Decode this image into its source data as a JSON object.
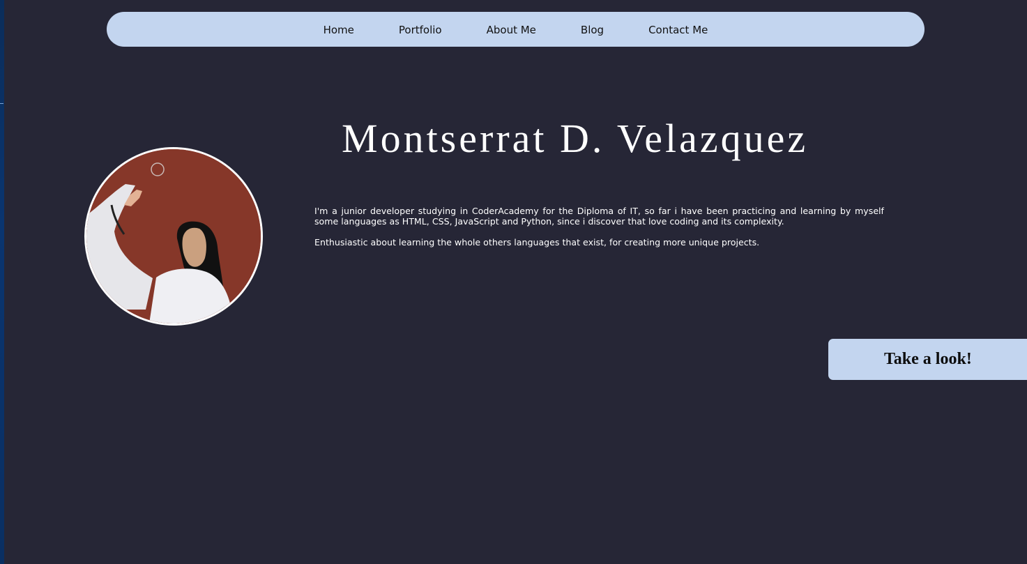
{
  "nav": {
    "items": [
      {
        "label": "Home"
      },
      {
        "label": "Portfolio"
      },
      {
        "label": "About Me"
      },
      {
        "label": "Blog"
      },
      {
        "label": "Contact Me"
      }
    ]
  },
  "hero": {
    "name": "Montserrat D. Velazquez",
    "bio": [
      "I'm a junior developer studying in CoderAcademy for the Diploma of IT, so far i have been practicing and learning by myself some languages as HTML, CSS, JavaScript and Python, since i discover that love coding and its complexity.",
      "Enthusiastic about learning the whole others languages that exist, for creating more unique projects."
    ]
  },
  "cta": {
    "label": "Take a look!"
  },
  "colors": {
    "background": "#262636",
    "accent": "#c3d5ef",
    "text": "#ffffff"
  },
  "icons": {
    "avatar": "profile-photo"
  }
}
